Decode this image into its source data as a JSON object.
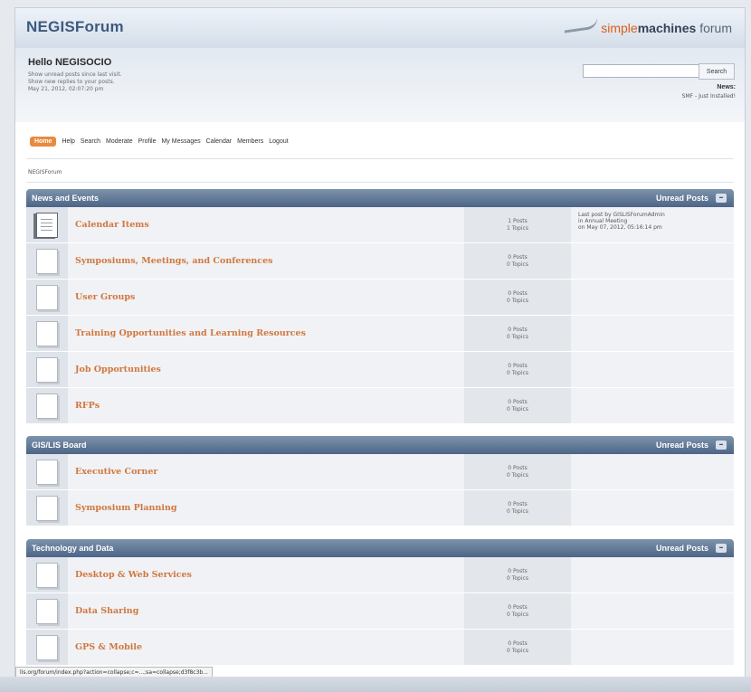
{
  "header": {
    "title": "NEGISForum",
    "logo": {
      "part1": "simple",
      "part2": "machines",
      "part3": " forum"
    }
  },
  "user": {
    "greeting": "Hello NEGISOCIO",
    "links": [
      "Show unread posts since last visit.",
      "Show new replies to your posts.",
      "May 21, 2012, 02:07:20 pm"
    ]
  },
  "search": {
    "placeholder": "",
    "button": "Search"
  },
  "news": {
    "heading": "News:",
    "text": "SMF - Just Installed!"
  },
  "menu": [
    "Home",
    "Help",
    "Search",
    "Moderate",
    "Profile",
    "My Messages",
    "Calendar",
    "Members",
    "Logout"
  ],
  "breadcrumb": "NEGISForum",
  "categories": [
    {
      "title": "News and Events",
      "unread": "Unread Posts",
      "collapse": "–",
      "boards": [
        {
          "name": "Calendar Items",
          "posts": "1 Posts",
          "topics": "1 Topics",
          "last": [
            "Last post by GISLISForumAdmin",
            "in Annual Meeting",
            "on May 07, 2012, 05:16:14 pm"
          ],
          "new": true
        },
        {
          "name": "Symposiums, Meetings, and Conferences",
          "posts": "0 Posts",
          "topics": "0 Topics",
          "last": [],
          "new": false
        },
        {
          "name": "User Groups",
          "posts": "0 Posts",
          "topics": "0 Topics",
          "last": [],
          "new": false
        },
        {
          "name": "Training Opportunities and Learning Resources",
          "posts": "0 Posts",
          "topics": "0 Topics",
          "last": [],
          "new": false
        },
        {
          "name": "Job Opportunities",
          "posts": "0 Posts",
          "topics": "0 Topics",
          "last": [],
          "new": false
        },
        {
          "name": "RFPs",
          "posts": "0 Posts",
          "topics": "0 Topics",
          "last": [],
          "new": false
        }
      ]
    },
    {
      "title": "GIS/LIS Board",
      "unread": "Unread Posts",
      "collapse": "–",
      "boards": [
        {
          "name": "Executive Corner",
          "posts": "0 Posts",
          "topics": "0 Topics",
          "last": [],
          "new": false
        },
        {
          "name": "Symposium Planning",
          "posts": "0 Posts",
          "topics": "0 Topics",
          "last": [],
          "new": false
        }
      ]
    },
    {
      "title": "Technology and Data",
      "unread": "Unread Posts",
      "collapse": "–",
      "boards": [
        {
          "name": "Desktop & Web Services",
          "posts": "0 Posts",
          "topics": "0 Topics",
          "last": [],
          "new": false
        },
        {
          "name": "Data Sharing",
          "posts": "0 Posts",
          "topics": "0 Topics",
          "last": [],
          "new": false
        },
        {
          "name": "GPS & Mobile",
          "posts": "0 Posts",
          "topics": "0 Topics",
          "last": [],
          "new": false
        }
      ]
    }
  ],
  "statusbar": "lis.org/forum/index.php?action=collapse;c=...;sa=collapse;d3f8c3b...",
  "colors": {
    "accent": "#d2773e",
    "category_header": "#5a7191",
    "menu_active": "#e98a3d"
  }
}
